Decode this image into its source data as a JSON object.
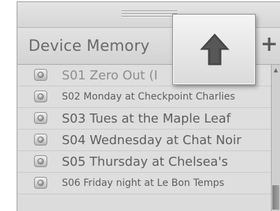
{
  "panel": {
    "title": "Device Memory",
    "add_glyph": "+",
    "add_icon": "plus-icon"
  },
  "popup": {
    "icon": "up-arrow-icon"
  },
  "scrollbar": {
    "up_glyph": "▲"
  },
  "list": {
    "items": [
      {
        "label": "S01 Zero Out (I"
      },
      {
        "label": "S02 Monday at Checkpoint Charlies"
      },
      {
        "label": "S03 Tues at the Maple Leaf"
      },
      {
        "label": "S04 Wednesday at Chat Noir"
      },
      {
        "label": "S05 Thursday at Chelsea's"
      },
      {
        "label": "S06 Friday night at Le Bon Temps"
      }
    ]
  },
  "colors": {
    "panel_bg": "#dcdcdc",
    "text": "#5e5e5e",
    "arrow": "#4a4a4a"
  }
}
